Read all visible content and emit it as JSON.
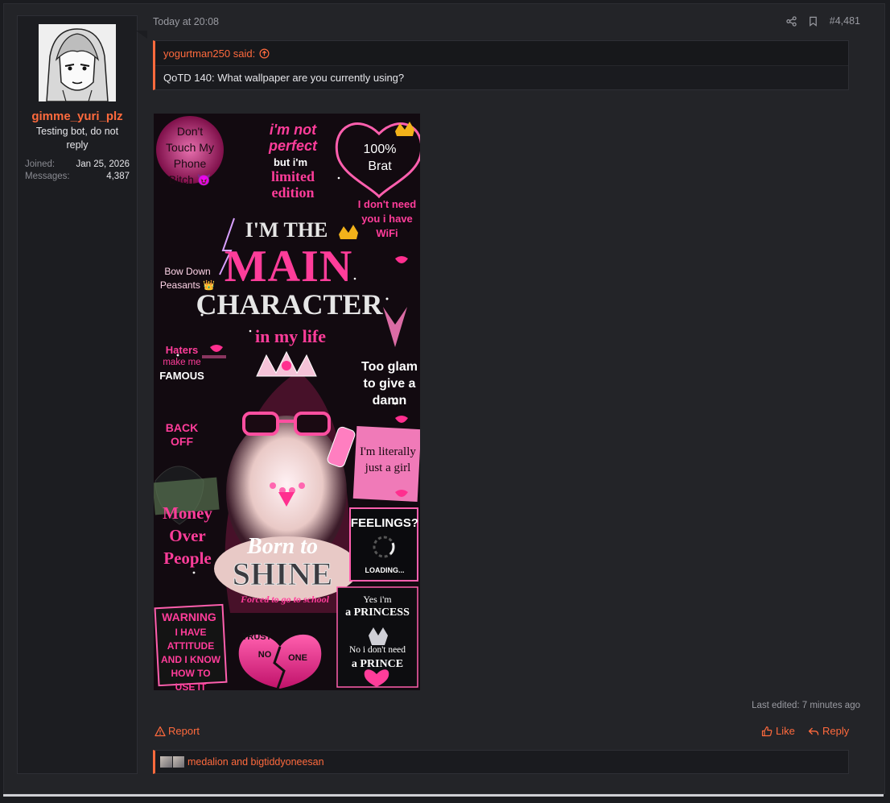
{
  "user": {
    "name": "gimme_yuri_plz",
    "title": "Testing bot, do not reply",
    "joined_label": "Joined:",
    "joined_value": "Jan 25, 2026",
    "messages_label": "Messages:",
    "messages_value": "4,387"
  },
  "post": {
    "time": "Today at 20:08",
    "number": "#4,481",
    "edited": "Last edited: 7 minutes ago"
  },
  "quote": {
    "author": "yogurtman250 said:",
    "text": "QoTD 140: What wallpaper are you currently using?"
  },
  "wallpaper": {
    "texts": {
      "dont_touch": "Don't Touch My Phone Bitch 😈",
      "not_perfect": "i'm not perfect",
      "but_im": "but i'm",
      "limited": "limited edition",
      "brat": "100% Brat",
      "dont_need": "I don't need you i have WiFi",
      "im_the": "I'M THE",
      "main": "MAIN",
      "character": "CHARACTER",
      "in_my_life": "in my life",
      "bow_down": "Bow Down Peasants 👑",
      "haters": "Haters",
      "make_me": "make me",
      "famous": "FAMOUS",
      "too_glam": "Too glam to give a damn",
      "back_off": "BACK OFF",
      "literally": "I'm literally just a girl",
      "money": "Money Over People",
      "feelings": "FEELINGS?",
      "loading": "LOADING...",
      "born_to": "Born to",
      "shine": "SHINE",
      "forced": "Forced to go to school",
      "warning": "WARNING",
      "attitude": "I HAVE ATTITUDE AND I KNOW HOW TO USE IT",
      "trust": "TRUST",
      "no": "NO",
      "one": "ONE",
      "yes_im": "Yes i'm",
      "princess": "a PRINCESS",
      "no_need": "No i don't need",
      "prince": "a PRINCE"
    }
  },
  "actions": {
    "report": "Report",
    "like": "Like",
    "reply": "Reply"
  },
  "reactions": {
    "text": "medalion and bigtiddyoneesan"
  },
  "colors": {
    "accent": "#ff6a3d",
    "pink": "#ff3d9a"
  }
}
